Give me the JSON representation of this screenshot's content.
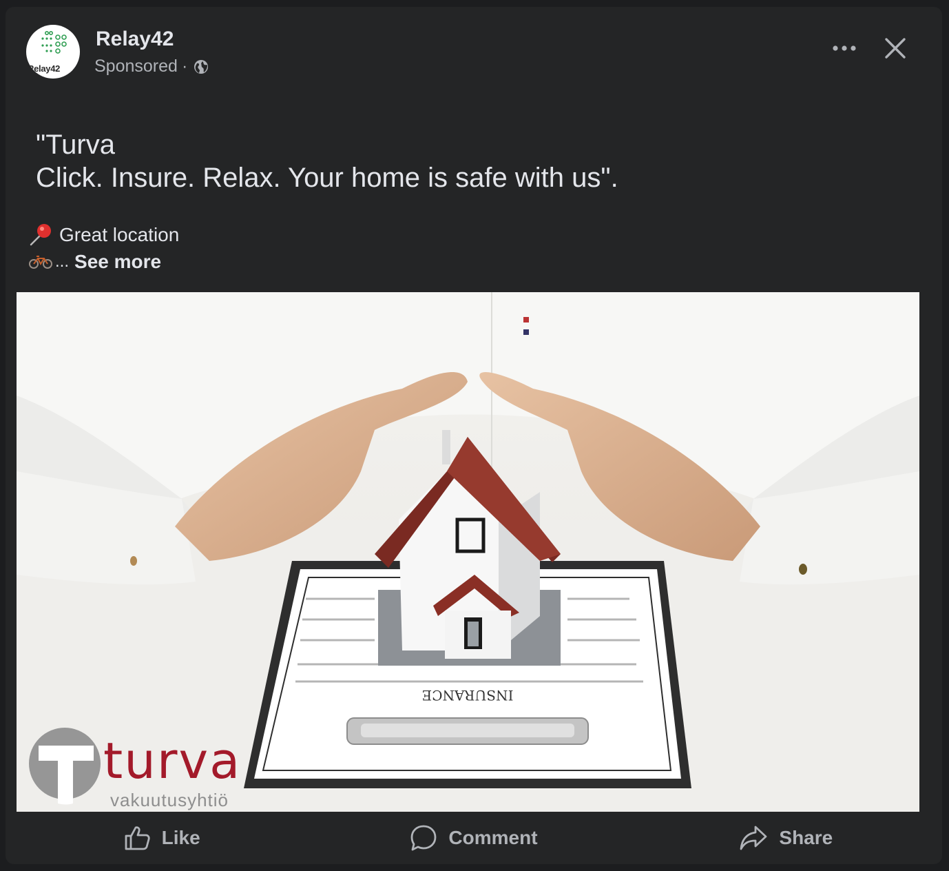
{
  "post": {
    "page_name": "Relay42",
    "sponsored_label": "Sponsored",
    "separator": "·",
    "avatar_text": "Relay42",
    "caption_text": "\"Turva\nClick. Insure. Relax. Your home is safe with us\".",
    "location_line": "Great location",
    "ellipsis": "...",
    "see_more": "See more"
  },
  "ad_image": {
    "document_label": "INSURANCE",
    "brand_name": "turva",
    "brand_subtitle": "vakuutusyhtiö",
    "brand_color": "#a31a2a"
  },
  "actions": {
    "like": "Like",
    "comment": "Comment",
    "share": "Share"
  },
  "icons": [
    "globe-icon",
    "more-options-icon",
    "close-icon",
    "pushpin-icon",
    "bicycle-icon",
    "like-icon",
    "comment-icon",
    "share-icon"
  ],
  "colors": {
    "card_background": "#242526",
    "primary_text": "#e4e6eb",
    "secondary_text": "#b0b3b8"
  }
}
